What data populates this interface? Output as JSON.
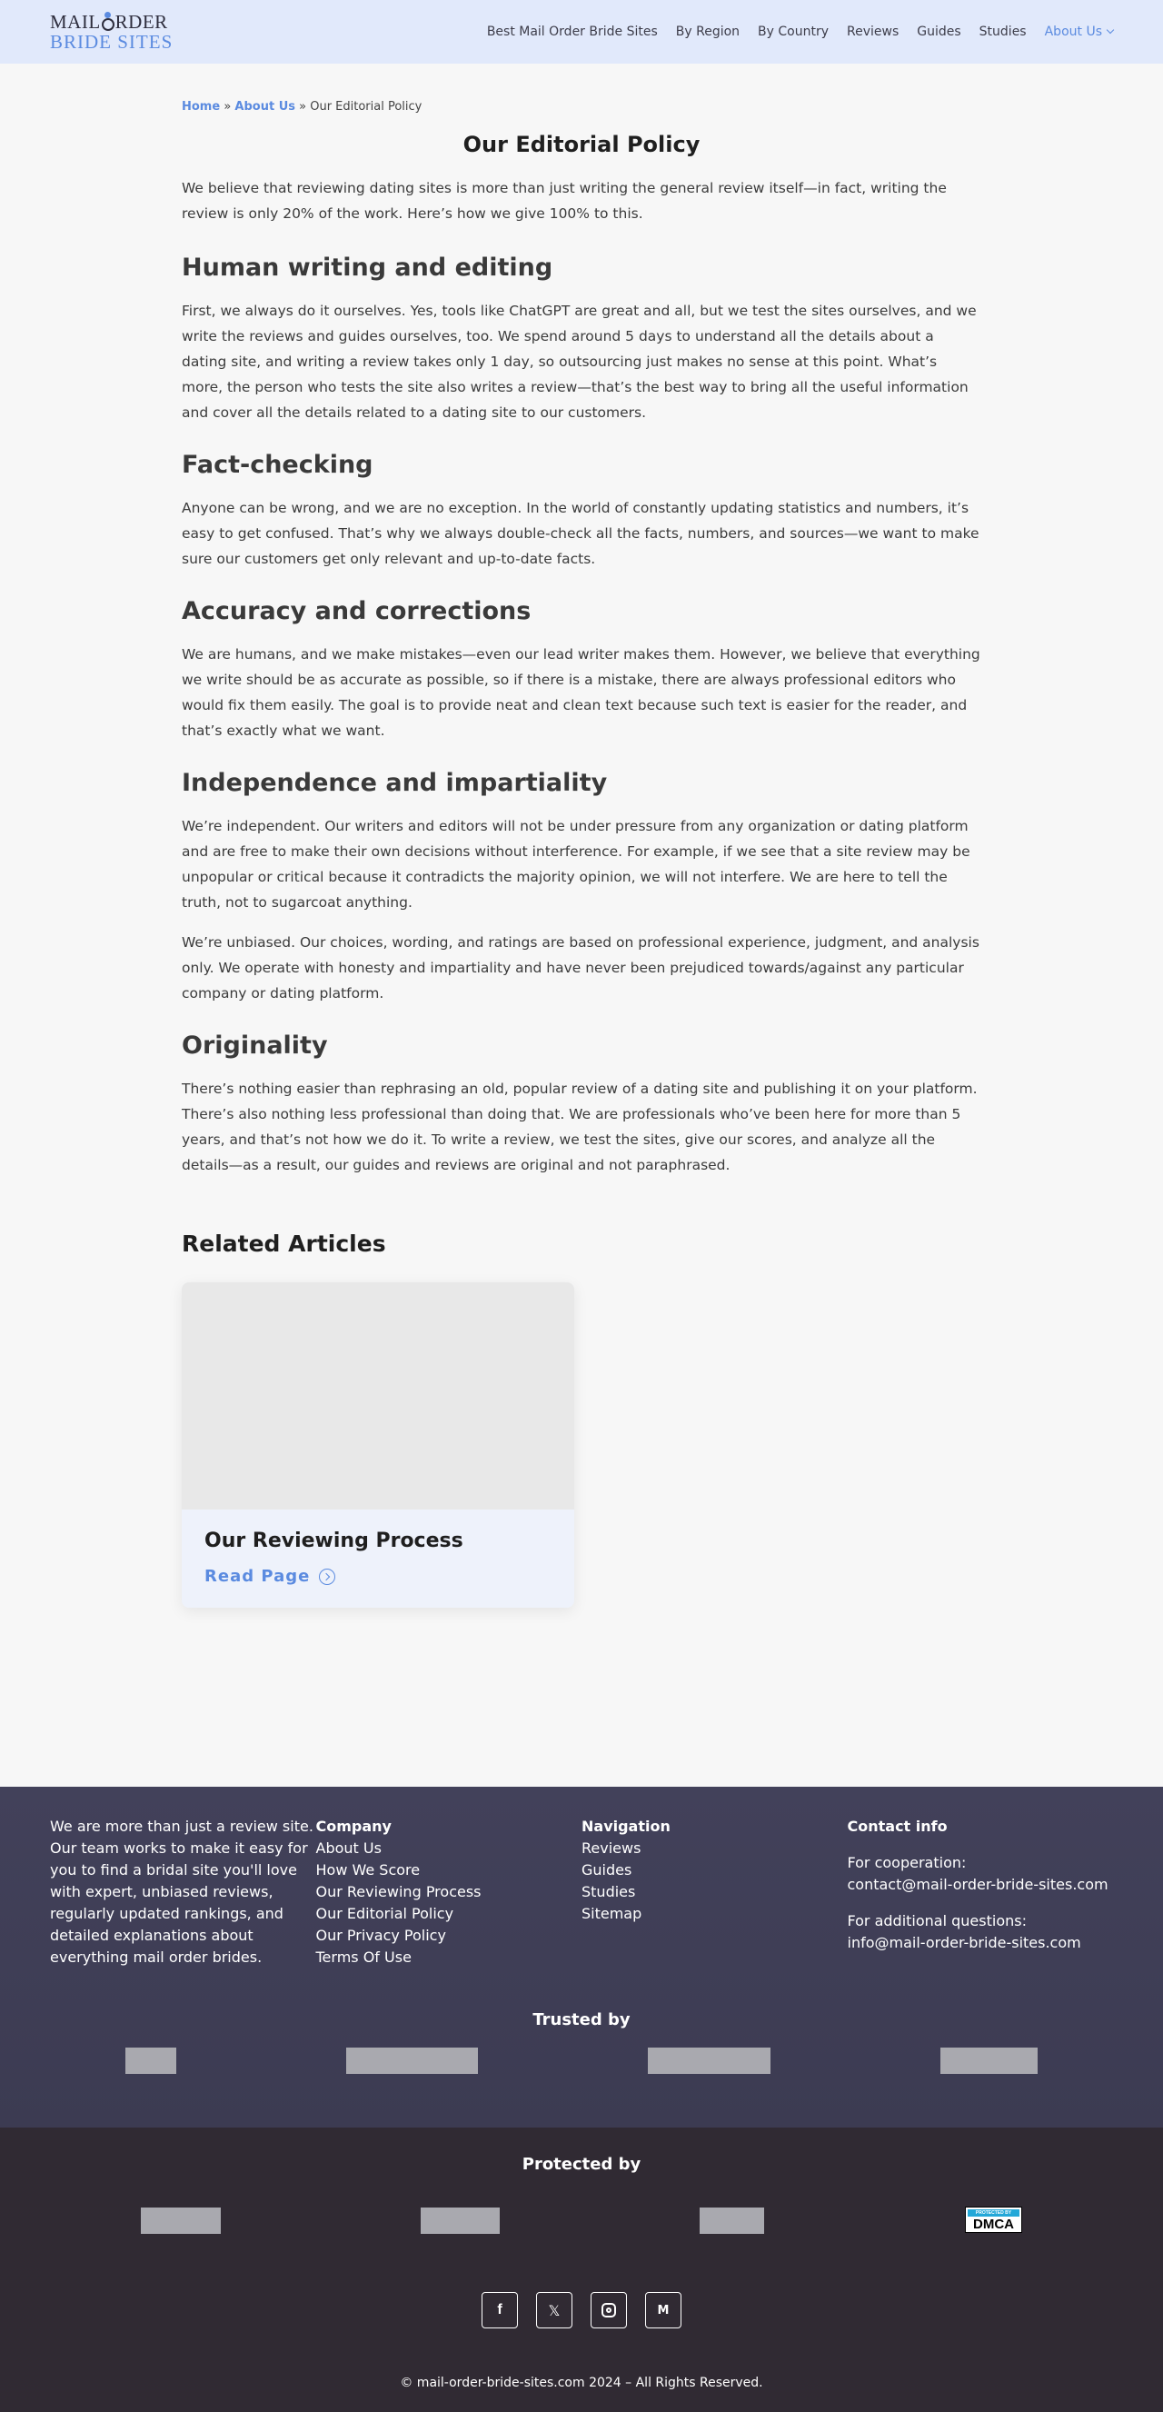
{
  "header": {
    "logo_top_left": "MAIL ",
    "logo_top_right": "RDER",
    "logo_bottom": "BRIDE SITES",
    "nav": [
      {
        "label": "Best Mail Order Bride Sites"
      },
      {
        "label": "By Region"
      },
      {
        "label": "By Country"
      },
      {
        "label": "Reviews"
      },
      {
        "label": "Guides"
      },
      {
        "label": "Studies"
      },
      {
        "label": "About Us",
        "active": true
      }
    ]
  },
  "breadcrumb": {
    "home": "Home",
    "sep": " » ",
    "about": "About Us",
    "current": "Our Editorial Policy"
  },
  "page": {
    "title": "Our Editorial Policy",
    "intro": "We believe that reviewing dating sites is more than just writing the general review itself—in fact, writing the review is only 20% of the work. Here’s how we give 100% to this.",
    "sections": [
      {
        "heading": "Human writing and editing",
        "paragraphs": [
          "First, we always do it ourselves. Yes, tools like ChatGPT are great and all, but we test the sites ourselves, and we write the reviews and guides ourselves, too. We spend around 5 days to understand all the details about a dating site, and writing a review takes only 1 day, so outsourcing just makes no sense at this point. What’s more, the person who tests the site also writes a review—that’s the best way to bring all the useful information and cover all the details related to a dating site to our customers."
        ]
      },
      {
        "heading": "Fact-checking",
        "paragraphs": [
          "Anyone can be wrong, and we are no exception. In the world of constantly updating statistics and numbers, it’s easy to get confused. That’s why we always double-check all the facts, numbers, and sources—we want to make sure our customers get only relevant and up-to-date facts."
        ]
      },
      {
        "heading": "Accuracy and corrections",
        "paragraphs": [
          "We are humans, and we make mistakes—even our lead writer makes them. However, we believe that everything we write should be as accurate as possible, so if there is a mistake, there are always professional editors who would fix them easily. The goal is to provide neat and clean text because such text is easier for the reader, and that’s exactly what we want."
        ]
      },
      {
        "heading": "Independence and impartiality",
        "paragraphs": [
          "We’re independent. Our writers and editors will not be under pressure from any organization or dating platform and are free to make their own decisions without interference. For example, if we see that a site review may be unpopular or critical because it contradicts the majority opinion, we will not interfere. We are here to tell the truth, not to sugarcoat anything.",
          "We’re unbiased. Our choices, wording, and ratings are based on professional experience, judgment, and analysis only. We operate with honesty and impartiality and have never been prejudiced towards/against any particular company or dating platform."
        ]
      },
      {
        "heading": "Originality",
        "paragraphs": [
          "There’s nothing easier than rephrasing an old, popular review of a dating site and publishing it on your platform. There’s also nothing less professional than doing that. We are professionals who’ve been here for more than 5 years, and that’s not how we do it. To write a review, we test the sites, give our scores, and analyze all the details—as a result, our guides and reviews are original and not paraphrased."
        ]
      }
    ],
    "related_title": "Related Articles",
    "related": [
      {
        "title": "Our Reviewing Process",
        "link": "Read Page"
      }
    ]
  },
  "footer": {
    "about": "We are more than just a review site. Our team works to make it easy for you to find a bridal site you'll love with expert, unbiased reviews, regularly updated rankings, and detailed explanations about everything mail order brides.",
    "company": {
      "title": "Company",
      "links": [
        "About Us",
        "How We Score",
        "Our Reviewing Process",
        "Our Editorial Policy",
        "Our Privacy Policy",
        "Terms Of Use"
      ]
    },
    "navigation": {
      "title": "Navigation",
      "links": [
        "Reviews",
        "Guides",
        "Studies",
        "Sitemap"
      ]
    },
    "contact": {
      "title": "Contact info",
      "cooperation_label": "For cooperation:",
      "cooperation_email": "contact@mail-order-bride-sites.com",
      "questions_label": "For additional questions:",
      "questions_email": "info@mail-order-bride-sites.com"
    },
    "trusted_title": "Trusted by",
    "protected_title": "Protected by",
    "dmca_top": "PROTECTED BY",
    "dmca_label": "DMCA",
    "copyright": "© mail-order-bride-sites.com 2024 – All Rights Reserved."
  },
  "colors": {
    "accent": "#5b8be0",
    "header_bg": "#e1e9fb",
    "footer_top_bg": "#42415a",
    "footer_bottom_bg": "#302a33"
  }
}
